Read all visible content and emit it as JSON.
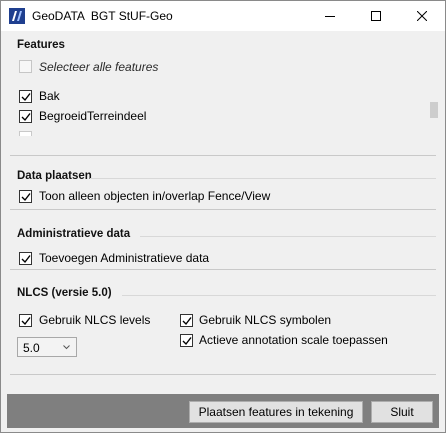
{
  "window": {
    "title": "GeoDATA  BGT StUF-Geo",
    "icons": {
      "app": "geodata-app-icon",
      "minimize": "minimize-icon",
      "maximize": "maximize-icon",
      "close": "close-icon"
    }
  },
  "features": {
    "title": "Features",
    "select_all_label": "Selecteer alle features",
    "select_all_enabled": false,
    "select_all_checked": false,
    "items": [
      {
        "label": "Bak",
        "checked": true
      },
      {
        "label": "BegroeidTerreindeel",
        "checked": true
      }
    ]
  },
  "data_plaatsen": {
    "title": "Data plaatsen",
    "fence_label": "Toon alleen objecten in/overlap Fence/View",
    "fence_checked": true
  },
  "administratieve": {
    "title": "Administratieve data",
    "add_label": "Toevoegen Administratieve data",
    "add_checked": true
  },
  "nlcs": {
    "title": "NLCS  (versie 5.0)",
    "levels_label": "Gebruik NLCS levels",
    "levels_checked": true,
    "symbols_label": "Gebruik NLCS symbolen",
    "symbols_checked": true,
    "annotation_label": "Actieve annotation scale toepassen",
    "annotation_checked": true,
    "version_selected": "5.0"
  },
  "footer": {
    "place_button": "Plaatsen features in tekening",
    "close_button": "Sluit"
  }
}
